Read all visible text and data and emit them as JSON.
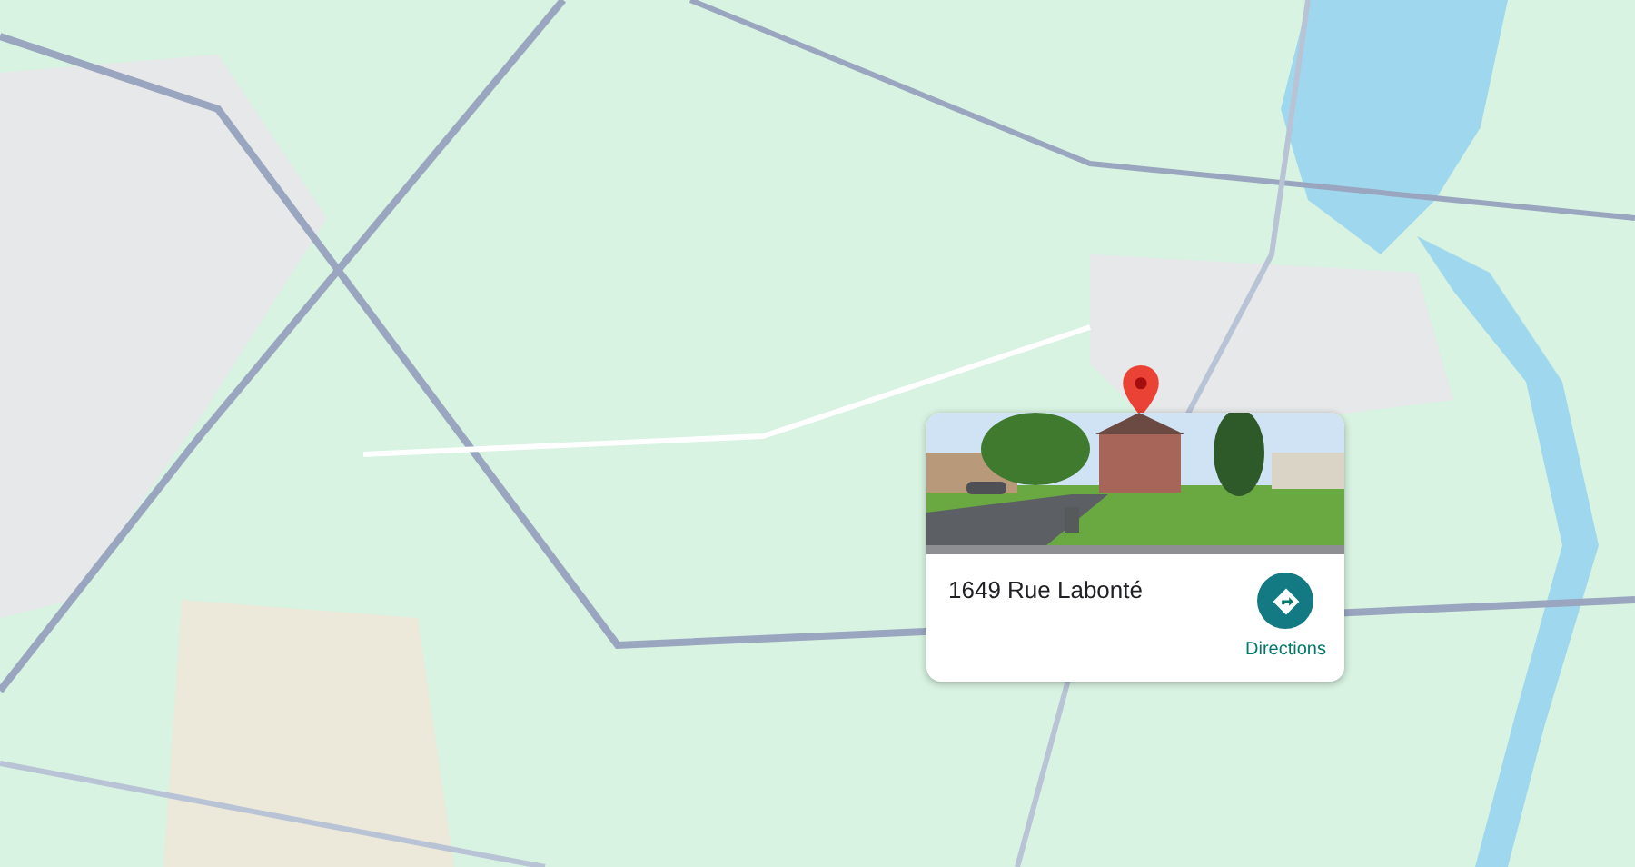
{
  "place_card": {
    "address": "1649 Rue Labonté",
    "action": "Directions"
  }
}
